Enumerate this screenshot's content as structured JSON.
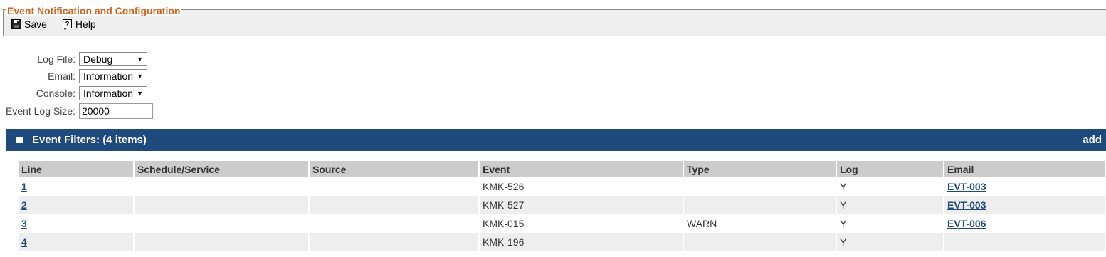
{
  "toolbar": {
    "title": "Event Notification and Configuration",
    "save_label": "Save",
    "help_label": "Help"
  },
  "form": {
    "log_file": {
      "label": "Log File:",
      "value": "Debug"
    },
    "email": {
      "label": "Email:",
      "value": "Information"
    },
    "console": {
      "label": "Console:",
      "value": "Information"
    },
    "event_log_size": {
      "label": "Event Log Size:",
      "value": "20000"
    }
  },
  "filters": {
    "title": "Event Filters: (4 items)",
    "add_label": "add",
    "columns": [
      "Line",
      "Schedule/Service",
      "Source",
      "Event",
      "Type",
      "Log",
      "Email"
    ],
    "rows": [
      {
        "line": "1",
        "schedule": "",
        "source": "",
        "event": "KMK-526",
        "type": "",
        "log": "Y",
        "email": "EVT-003"
      },
      {
        "line": "2",
        "schedule": "",
        "source": "",
        "event": "KMK-527",
        "type": "",
        "log": "Y",
        "email": "EVT-003"
      },
      {
        "line": "3",
        "schedule": "",
        "source": "",
        "event": "KMK-015",
        "type": "WARN",
        "log": "Y",
        "email": "EVT-006"
      },
      {
        "line": "4",
        "schedule": "",
        "source": "",
        "event": "KMK-196",
        "type": "",
        "log": "Y",
        "email": ""
      }
    ]
  },
  "colors": {
    "legend": "#d0631d",
    "header_bar": "#1f4a7e",
    "link": "#1f4a7e",
    "table_header": "#cccccc",
    "row_alt": "#eeeeee"
  },
  "icons": {
    "save": "floppy-disk-icon",
    "help": "help-icon",
    "collapse": "collapse-icon",
    "dropdown": "chevron-down-icon"
  }
}
